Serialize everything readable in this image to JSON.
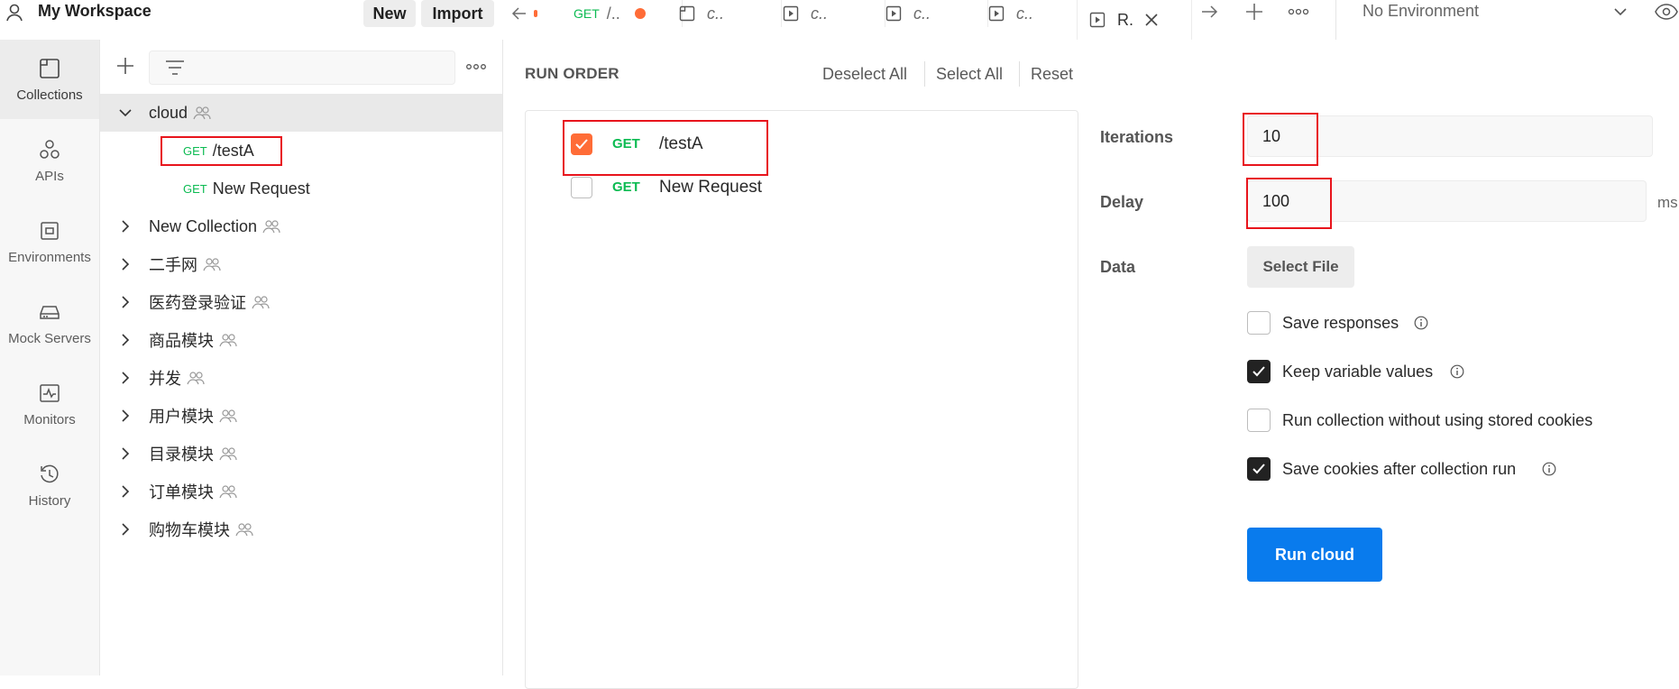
{
  "header": {
    "workspace_title": "My Workspace",
    "new_label": "New",
    "import_label": "Import"
  },
  "tabs": [
    {
      "method": "GET",
      "label": "/.."
    },
    {
      "label": "c.."
    },
    {
      "label": "c.."
    },
    {
      "label": "c.."
    },
    {
      "label": "c.."
    },
    {
      "label": "R."
    }
  ],
  "environment": {
    "selected": "No Environment"
  },
  "rail": {
    "items": [
      {
        "label": "Collections",
        "icon": "collections-icon"
      },
      {
        "label": "APIs",
        "icon": "apis-icon"
      },
      {
        "label": "Environments",
        "icon": "environments-icon"
      },
      {
        "label": "Mock Servers",
        "icon": "mock-servers-icon"
      },
      {
        "label": "Monitors",
        "icon": "monitors-icon"
      },
      {
        "label": "History",
        "icon": "history-icon"
      }
    ]
  },
  "tree": {
    "cloud": "cloud",
    "requests": [
      {
        "method": "GET",
        "name": "/testA"
      },
      {
        "method": "GET",
        "name": "New Request"
      }
    ],
    "collections": [
      "New Collection",
      "二手网",
      "医药登录验证",
      "商品模块",
      "并发",
      "用户模块",
      "目录模块",
      "订单模块",
      "购物车模块"
    ]
  },
  "run_order": {
    "title": "RUN ORDER",
    "deselect_all": "Deselect All",
    "select_all": "Select All",
    "reset": "Reset",
    "items": [
      {
        "method": "GET",
        "name": "/testA",
        "checked": true
      },
      {
        "method": "GET",
        "name": "New Request",
        "checked": false
      }
    ]
  },
  "settings": {
    "iterations_label": "Iterations",
    "iterations_value": "10",
    "delay_label": "Delay",
    "delay_value": "100",
    "delay_unit": "ms",
    "data_label": "Data",
    "select_file": "Select File",
    "options": [
      {
        "label": "Save responses",
        "checked": false,
        "info": true
      },
      {
        "label": "Keep variable values",
        "checked": true,
        "info": true
      },
      {
        "label": "Run collection without using stored cookies",
        "checked": false,
        "info": false
      },
      {
        "label": "Save cookies after collection run",
        "checked": true,
        "info": true
      }
    ],
    "run_button": "Run cloud"
  },
  "colors": {
    "accent_orange": "#ff6c37",
    "get_green": "#0cbb52",
    "run_blue": "#097bed",
    "highlight_red": "#e8141c"
  }
}
